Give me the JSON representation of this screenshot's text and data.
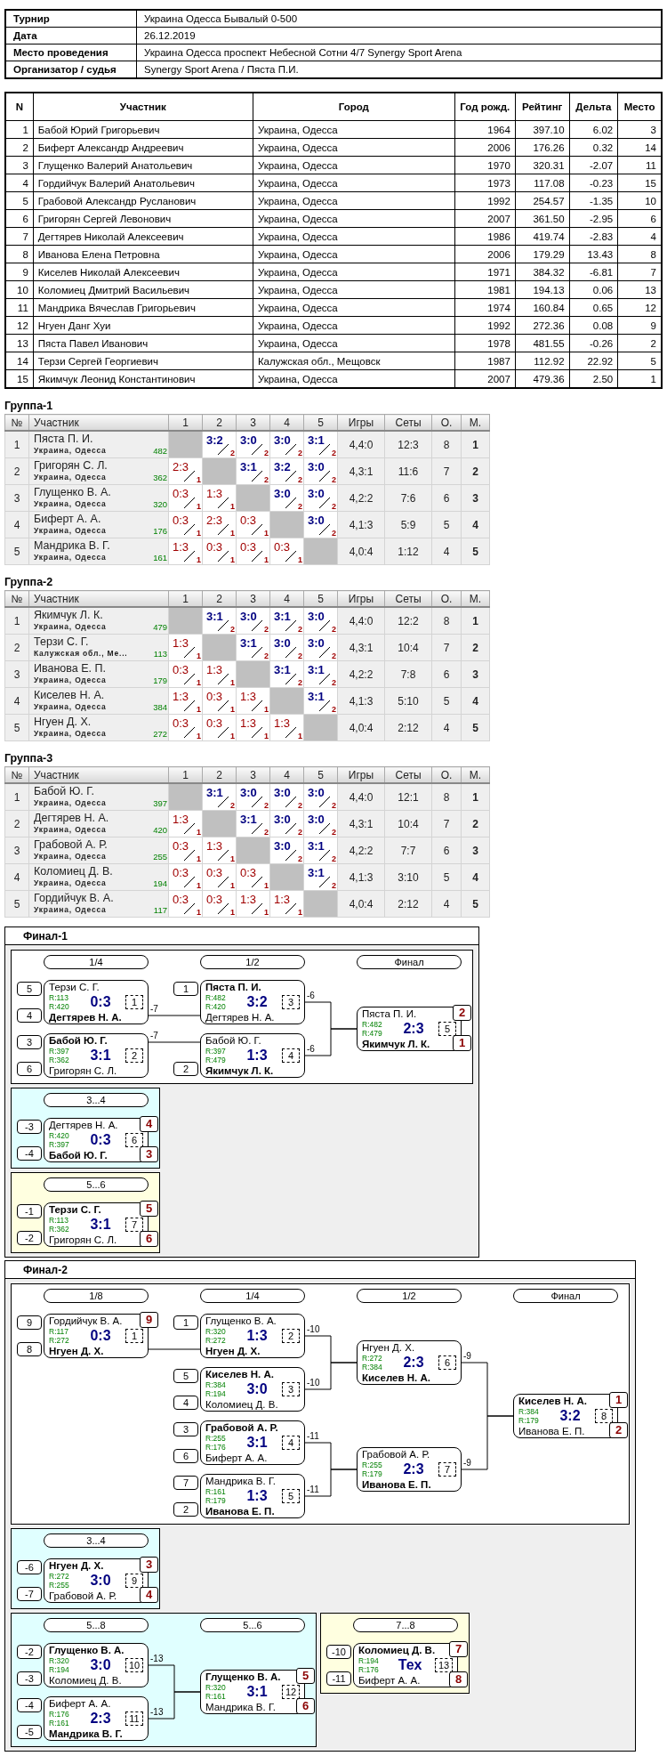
{
  "info": [
    {
      "label": "Турнир",
      "value": "Украина Одесса Бывалый 0-500"
    },
    {
      "label": "Дата",
      "value": "26.12.2019"
    },
    {
      "label": "Место проведения",
      "value": "Украина Одесса проспект Небесной Сотни 4/7 Synergy Sport Arena"
    },
    {
      "label": "Организатор / судья",
      "value": "Synergy Sport Arena / Пяста П.И."
    }
  ],
  "players": {
    "columns": [
      "N",
      "Участник",
      "Город",
      "Год рожд.",
      "Рейтинг",
      "Дельта",
      "Место"
    ],
    "rows": [
      [
        "1",
        "Бабой Юрий Григорьевич",
        "Украина, Одесса",
        "1964",
        "397.10",
        "6.02",
        "3"
      ],
      [
        "2",
        "Биферт Александр Андреевич",
        "Украина, Одесса",
        "2006",
        "176.26",
        "0.32",
        "14"
      ],
      [
        "3",
        "Глущенко Валерий Анатольевич",
        "Украина, Одесса",
        "1970",
        "320.31",
        "-2.07",
        "11"
      ],
      [
        "4",
        "Гордийчук Валерий Анатольевич",
        "Украина, Одесса",
        "1973",
        "117.08",
        "-0.23",
        "15"
      ],
      [
        "5",
        "Грабовой Александр Русланович",
        "Украина, Одесса",
        "1992",
        "254.57",
        "-1.35",
        "10"
      ],
      [
        "6",
        "Григорян Сергей Левонович",
        "Украина, Одесса",
        "2007",
        "361.50",
        "-2.95",
        "6"
      ],
      [
        "7",
        "Дегтярев Николай Алексеевич",
        "Украина, Одесса",
        "1986",
        "419.74",
        "-2.83",
        "4"
      ],
      [
        "8",
        "Иванова Елена Петровна",
        "Украина, Одесса",
        "2006",
        "179.29",
        "13.43",
        "8"
      ],
      [
        "9",
        "Киселев Николай Алексеевич",
        "Украина, Одесса",
        "1971",
        "384.32",
        "-6.81",
        "7"
      ],
      [
        "10",
        "Коломиец Дмитрий Васильевич",
        "Украина, Одесса",
        "1981",
        "194.13",
        "0.06",
        "13"
      ],
      [
        "11",
        "Мандрика Вячеслав Григорьевич",
        "Украина, Одесса",
        "1974",
        "160.84",
        "0.65",
        "12"
      ],
      [
        "12",
        "Нгуен Данг Хуи",
        "Украина, Одесса",
        "1992",
        "272.36",
        "0.08",
        "9"
      ],
      [
        "13",
        "Пяста Павел Иванович",
        "Украина, Одесса",
        "1978",
        "481.55",
        "-0.26",
        "2"
      ],
      [
        "14",
        "Терзи Сергей Георгиевич",
        "Калужская обл., Мещовск",
        "1987",
        "112.92",
        "22.92",
        "5"
      ],
      [
        "15",
        "Якимчук Леонид Константинович",
        "Украина, Одесса",
        "2007",
        "479.36",
        "2.50",
        "1"
      ]
    ]
  },
  "groups": [
    {
      "title": "Группа-1",
      "columns": [
        "№",
        "Участник"
      ],
      "opponents": [
        "1",
        "2",
        "3",
        "4",
        "5"
      ],
      "totals": [
        "Игры",
        "Сеты",
        "О.",
        "М."
      ],
      "rows": [
        {
          "no": "1",
          "player": {
            "name": "Пяста П. И.",
            "city": "Украина, Одесса",
            "rating": "482"
          },
          "cells": [
            {
              "kind": "self"
            },
            {
              "kind": "win",
              "score": "3:2",
              "points": "2"
            },
            {
              "kind": "win",
              "score": "3:0",
              "points": "2"
            },
            {
              "kind": "win",
              "score": "3:0",
              "points": "2"
            },
            {
              "kind": "win",
              "score": "3:1",
              "points": "2"
            }
          ],
          "games": "4,4:0",
          "sets": "12:3",
          "points": "8",
          "place": "1"
        },
        {
          "no": "2",
          "player": {
            "name": "Григорян С. Л.",
            "city": "Украина, Одесса",
            "rating": "362"
          },
          "cells": [
            {
              "kind": "loss",
              "score": "2:3",
              "points": "1"
            },
            {
              "kind": "self"
            },
            {
              "kind": "win",
              "score": "3:1",
              "points": "2"
            },
            {
              "kind": "win",
              "score": "3:2",
              "points": "2"
            },
            {
              "kind": "win",
              "score": "3:0",
              "points": "2"
            }
          ],
          "games": "4,3:1",
          "sets": "11:6",
          "points": "7",
          "place": "2"
        },
        {
          "no": "3",
          "player": {
            "name": "Глущенко В. А.",
            "city": "Украина, Одесса",
            "rating": "320"
          },
          "cells": [
            {
              "kind": "loss",
              "score": "0:3",
              "points": "1"
            },
            {
              "kind": "loss",
              "score": "1:3",
              "points": "1"
            },
            {
              "kind": "self"
            },
            {
              "kind": "win",
              "score": "3:0",
              "points": "2"
            },
            {
              "kind": "win",
              "score": "3:0",
              "points": "2"
            }
          ],
          "games": "4,2:2",
          "sets": "7:6",
          "points": "6",
          "place": "3"
        },
        {
          "no": "4",
          "player": {
            "name": "Биферт А. А.",
            "city": "Украина, Одесса",
            "rating": "176"
          },
          "cells": [
            {
              "kind": "loss",
              "score": "0:3",
              "points": "1"
            },
            {
              "kind": "loss",
              "score": "2:3",
              "points": "1"
            },
            {
              "kind": "loss",
              "score": "0:3",
              "points": "1"
            },
            {
              "kind": "self"
            },
            {
              "kind": "win",
              "score": "3:0",
              "points": "2"
            }
          ],
          "games": "4,1:3",
          "sets": "5:9",
          "points": "5",
          "place": "4"
        },
        {
          "no": "5",
          "player": {
            "name": "Мандрика В. Г.",
            "city": "Украина, Одесса",
            "rating": "161"
          },
          "cells": [
            {
              "kind": "loss",
              "score": "1:3",
              "points": "1"
            },
            {
              "kind": "loss",
              "score": "0:3",
              "points": "1"
            },
            {
              "kind": "loss",
              "score": "0:3",
              "points": "1"
            },
            {
              "kind": "loss",
              "score": "0:3",
              "points": "1"
            },
            {
              "kind": "self"
            }
          ],
          "games": "4,0:4",
          "sets": "1:12",
          "points": "4",
          "place": "5"
        }
      ]
    },
    {
      "title": "Группа-2",
      "columns": [
        "№",
        "Участник"
      ],
      "opponents": [
        "1",
        "2",
        "3",
        "4",
        "5"
      ],
      "totals": [
        "Игры",
        "Сеты",
        "О.",
        "М."
      ],
      "rows": [
        {
          "no": "1",
          "player": {
            "name": "Якимчук Л. К.",
            "city": "Украина, Одесса",
            "rating": "479"
          },
          "cells": [
            {
              "kind": "self"
            },
            {
              "kind": "win",
              "score": "3:1",
              "points": "2"
            },
            {
              "kind": "win",
              "score": "3:0",
              "points": "2"
            },
            {
              "kind": "win",
              "score": "3:1",
              "points": "2"
            },
            {
              "kind": "win",
              "score": "3:0",
              "points": "2"
            }
          ],
          "games": "4,4:0",
          "sets": "12:2",
          "points": "8",
          "place": "1"
        },
        {
          "no": "2",
          "player": {
            "name": "Терзи С. Г.",
            "city": "Калужская обл., Ме...",
            "rating": "113"
          },
          "cells": [
            {
              "kind": "loss",
              "score": "1:3",
              "points": "1"
            },
            {
              "kind": "self"
            },
            {
              "kind": "win",
              "score": "3:1",
              "points": "2"
            },
            {
              "kind": "win",
              "score": "3:0",
              "points": "2"
            },
            {
              "kind": "win",
              "score": "3:0",
              "points": "2"
            }
          ],
          "games": "4,3:1",
          "sets": "10:4",
          "points": "7",
          "place": "2"
        },
        {
          "no": "3",
          "player": {
            "name": "Иванова Е. П.",
            "city": "Украина, Одесса",
            "rating": "179"
          },
          "cells": [
            {
              "kind": "loss",
              "score": "0:3",
              "points": "1"
            },
            {
              "kind": "loss",
              "score": "1:3",
              "points": "1"
            },
            {
              "kind": "self"
            },
            {
              "kind": "win",
              "score": "3:1",
              "points": "2"
            },
            {
              "kind": "win",
              "score": "3:1",
              "points": "2"
            }
          ],
          "games": "4,2:2",
          "sets": "7:8",
          "points": "6",
          "place": "3"
        },
        {
          "no": "4",
          "player": {
            "name": "Киселев Н. А.",
            "city": "Украина, Одесса",
            "rating": "384"
          },
          "cells": [
            {
              "kind": "loss",
              "score": "1:3",
              "points": "1"
            },
            {
              "kind": "loss",
              "score": "0:3",
              "points": "1"
            },
            {
              "kind": "loss",
              "score": "1:3",
              "points": "1"
            },
            {
              "kind": "self"
            },
            {
              "kind": "win",
              "score": "3:1",
              "points": "2"
            }
          ],
          "games": "4,1:3",
          "sets": "5:10",
          "points": "5",
          "place": "4"
        },
        {
          "no": "5",
          "player": {
            "name": "Нгуен Д. Х.",
            "city": "Украина, Одесса",
            "rating": "272"
          },
          "cells": [
            {
              "kind": "loss",
              "score": "0:3",
              "points": "1"
            },
            {
              "kind": "loss",
              "score": "0:3",
              "points": "1"
            },
            {
              "kind": "loss",
              "score": "1:3",
              "points": "1"
            },
            {
              "kind": "loss",
              "score": "1:3",
              "points": "1"
            },
            {
              "kind": "self"
            }
          ],
          "games": "4,0:4",
          "sets": "2:12",
          "points": "4",
          "place": "5"
        }
      ]
    },
    {
      "title": "Группа-3",
      "columns": [
        "№",
        "Участник"
      ],
      "opponents": [
        "1",
        "2",
        "3",
        "4",
        "5"
      ],
      "totals": [
        "Игры",
        "Сеты",
        "О.",
        "М."
      ],
      "rows": [
        {
          "no": "1",
          "player": {
            "name": "Бабой Ю. Г.",
            "city": "Украина, Одесса",
            "rating": "397"
          },
          "cells": [
            {
              "kind": "self"
            },
            {
              "kind": "win",
              "score": "3:1",
              "points": "2"
            },
            {
              "kind": "win",
              "score": "3:0",
              "points": "2"
            },
            {
              "kind": "win",
              "score": "3:0",
              "points": "2"
            },
            {
              "kind": "win",
              "score": "3:0",
              "points": "2"
            }
          ],
          "games": "4,4:0",
          "sets": "12:1",
          "points": "8",
          "place": "1"
        },
        {
          "no": "2",
          "player": {
            "name": "Дегтярев Н. А.",
            "city": "Украина, Одесса",
            "rating": "420"
          },
          "cells": [
            {
              "kind": "loss",
              "score": "1:3",
              "points": "1"
            },
            {
              "kind": "self"
            },
            {
              "kind": "win",
              "score": "3:1",
              "points": "2"
            },
            {
              "kind": "win",
              "score": "3:0",
              "points": "2"
            },
            {
              "kind": "win",
              "score": "3:0",
              "points": "2"
            }
          ],
          "games": "4,3:1",
          "sets": "10:4",
          "points": "7",
          "place": "2"
        },
        {
          "no": "3",
          "player": {
            "name": "Грабовой А. Р.",
            "city": "Украина, Одесса",
            "rating": "255"
          },
          "cells": [
            {
              "kind": "loss",
              "score": "0:3",
              "points": "1"
            },
            {
              "kind": "loss",
              "score": "1:3",
              "points": "1"
            },
            {
              "kind": "self"
            },
            {
              "kind": "win",
              "score": "3:0",
              "points": "2"
            },
            {
              "kind": "win",
              "score": "3:1",
              "points": "2"
            }
          ],
          "games": "4,2:2",
          "sets": "7:7",
          "points": "6",
          "place": "3"
        },
        {
          "no": "4",
          "player": {
            "name": "Коломиец Д. В.",
            "city": "Украина, Одесса",
            "rating": "194"
          },
          "cells": [
            {
              "kind": "loss",
              "score": "0:3",
              "points": "1"
            },
            {
              "kind": "loss",
              "score": "0:3",
              "points": "1"
            },
            {
              "kind": "loss",
              "score": "0:3",
              "points": "1"
            },
            {
              "kind": "self"
            },
            {
              "kind": "win",
              "score": "3:1",
              "points": "2"
            }
          ],
          "games": "4,1:3",
          "sets": "3:10",
          "points": "5",
          "place": "4"
        },
        {
          "no": "5",
          "player": {
            "name": "Гордийчук В. А.",
            "city": "Украина, Одесса",
            "rating": "117"
          },
          "cells": [
            {
              "kind": "loss",
              "score": "0:3",
              "points": "1"
            },
            {
              "kind": "loss",
              "score": "0:3",
              "points": "1"
            },
            {
              "kind": "loss",
              "score": "1:3",
              "points": "1"
            },
            {
              "kind": "loss",
              "score": "1:3",
              "points": "1"
            },
            {
              "kind": "self"
            }
          ],
          "games": "4,0:4",
          "sets": "2:12",
          "points": "4",
          "place": "5"
        }
      ]
    }
  ],
  "finals": [
    {
      "title": "Финал-1",
      "panel_rows": [
        [
          {
            "color": "#ffffff",
            "rounds": [
              {
                "title": "1/4",
                "matches": [
                  {
                    "top": {
                      "seed": "5",
                      "name": "Терзи С. Г.",
                      "rating": "R:113",
                      "winner": false
                    },
                    "bottom": {
                      "seed": "4",
                      "name": "Дегтярев Н. А.",
                      "rating": "R:420",
                      "winner": true
                    },
                    "score": "0:3",
                    "number": "1",
                    "loser_to": "-7"
                  },
                  {
                    "top": {
                      "seed": "3",
                      "name": "Бабой Ю. Г.",
                      "rating": "R:397",
                      "winner": true
                    },
                    "bottom": {
                      "seed": "6",
                      "name": "Григорян С. Л.",
                      "rating": "R:362",
                      "winner": false
                    },
                    "score": "3:1",
                    "number": "2",
                    "loser_to": "-7"
                  }
                ]
              },
              {
                "title": "1/2",
                "matches": [
                  {
                    "top": {
                      "seed": "1",
                      "name": "Пяста П. И.",
                      "rating": "R:482",
                      "winner": true
                    },
                    "bottom": {
                      "name": "Дегтярев Н. А.",
                      "rating": "R:420",
                      "winner": false
                    },
                    "score": "3:2",
                    "number": "3",
                    "loser_to": "-6"
                  },
                  {
                    "top": {
                      "name": "Бабой Ю. Г.",
                      "rating": "R:397",
                      "winner": false
                    },
                    "bottom": {
                      "seed": "2",
                      "name": "Якимчук Л. К.",
                      "rating": "R:479",
                      "winner": true
                    },
                    "score": "1:3",
                    "number": "4",
                    "loser_to": "-6"
                  }
                ]
              },
              {
                "title": "Финал",
                "matches": [
                  {
                    "top": {
                      "name": "Пяста П. И.",
                      "rating": "R:482",
                      "winner": false,
                      "place": "2"
                    },
                    "bottom": {
                      "name": "Якимчук Л. К.",
                      "rating": "R:479",
                      "winner": true,
                      "place": "1"
                    },
                    "score": "2:3",
                    "number": "5"
                  }
                ]
              }
            ]
          }
        ],
        [
          {
            "color": "#e0ffff",
            "rounds": [
              {
                "title": "3...4",
                "matches": [
                  {
                    "top": {
                      "seed": "-3",
                      "name": "Дегтярев Н. А.",
                      "rating": "R:420",
                      "winner": false,
                      "place": "4"
                    },
                    "bottom": {
                      "seed": "-4",
                      "name": "Бабой Ю. Г.",
                      "rating": "R:397",
                      "winner": true,
                      "place": "3"
                    },
                    "score": "0:3",
                    "number": "6"
                  }
                ]
              }
            ]
          }
        ],
        [
          {
            "color": "#ffffe0",
            "rounds": [
              {
                "title": "5...6",
                "matches": [
                  {
                    "top": {
                      "seed": "-1",
                      "name": "Терзи С. Г.",
                      "rating": "R:113",
                      "winner": true,
                      "place": "5"
                    },
                    "bottom": {
                      "seed": "-2",
                      "name": "Григорян С. Л.",
                      "rating": "R:362",
                      "winner": false,
                      "place": "6"
                    },
                    "score": "3:1",
                    "number": "7"
                  }
                ]
              }
            ]
          }
        ]
      ]
    },
    {
      "title": "Финал-2",
      "panel_rows": [
        [
          {
            "color": "#ffffff",
            "rounds": [
              {
                "title": "1/8",
                "matches": [
                  {
                    "top": {
                      "seed": "9",
                      "name": "Гордийчук В. А.",
                      "rating": "R:117",
                      "winner": false,
                      "place": "9"
                    },
                    "bottom": {
                      "seed": "8",
                      "name": "Нгуен Д. Х.",
                      "rating": "R:272",
                      "winner": true
                    },
                    "score": "0:3",
                    "number": "1"
                  }
                ]
              },
              {
                "title": "1/4",
                "matches": [
                  {
                    "top": {
                      "seed": "1",
                      "name": "Глущенко В. А.",
                      "rating": "R:320",
                      "winner": false
                    },
                    "bottom": {
                      "name": "Нгуен Д. Х.",
                      "rating": "R:272",
                      "winner": true
                    },
                    "score": "1:3",
                    "number": "2",
                    "loser_to": "-10"
                  },
                  {
                    "top": {
                      "seed": "5",
                      "name": "Киселев Н. А.",
                      "rating": "R:384",
                      "winner": true
                    },
                    "bottom": {
                      "seed": "4",
                      "name": "Коломиец Д. В.",
                      "rating": "R:194",
                      "winner": false
                    },
                    "score": "3:0",
                    "number": "3",
                    "loser_to": "-10"
                  },
                  {
                    "top": {
                      "seed": "3",
                      "name": "Грабовой А. Р.",
                      "rating": "R:255",
                      "winner": true
                    },
                    "bottom": {
                      "seed": "6",
                      "name": "Биферт А. А.",
                      "rating": "R:176",
                      "winner": false
                    },
                    "score": "3:1",
                    "number": "4",
                    "loser_to": "-11"
                  },
                  {
                    "top": {
                      "seed": "7",
                      "name": "Мандрика В. Г.",
                      "rating": "R:161",
                      "winner": false
                    },
                    "bottom": {
                      "seed": "2",
                      "name": "Иванова Е. П.",
                      "rating": "R:179",
                      "winner": true
                    },
                    "score": "1:3",
                    "number": "5",
                    "loser_to": "-11"
                  }
                ]
              },
              {
                "title": "1/2",
                "matches": [
                  {
                    "top": {
                      "name": "Нгуен Д. Х.",
                      "rating": "R:272",
                      "winner": false
                    },
                    "bottom": {
                      "name": "Киселев Н. А.",
                      "rating": "R:384",
                      "winner": true
                    },
                    "score": "2:3",
                    "number": "6",
                    "loser_to": "-9"
                  },
                  {
                    "top": {
                      "name": "Грабовой А. Р.",
                      "rating": "R:255",
                      "winner": false
                    },
                    "bottom": {
                      "name": "Иванова Е. П.",
                      "rating": "R:179",
                      "winner": true
                    },
                    "score": "2:3",
                    "number": "7",
                    "loser_to": "-9"
                  }
                ]
              },
              {
                "title": "Финал",
                "matches": [
                  {
                    "top": {
                      "name": "Киселев Н. А.",
                      "rating": "R:384",
                      "winner": true,
                      "place": "1"
                    },
                    "bottom": {
                      "name": "Иванова Е. П.",
                      "rating": "R:179",
                      "winner": false,
                      "place": "2"
                    },
                    "score": "3:2",
                    "number": "8"
                  }
                ]
              }
            ]
          }
        ],
        [
          {
            "color": "#e0ffff",
            "rounds": [
              {
                "title": "3...4",
                "matches": [
                  {
                    "top": {
                      "seed": "-6",
                      "name": "Нгуен Д. Х.",
                      "rating": "R:272",
                      "winner": true,
                      "place": "3"
                    },
                    "bottom": {
                      "seed": "-7",
                      "name": "Грабовой А. Р.",
                      "rating": "R:255",
                      "winner": false,
                      "place": "4"
                    },
                    "score": "3:0",
                    "number": "9"
                  }
                ]
              }
            ]
          }
        ],
        [
          {
            "color": "#e0ffff",
            "rounds": [
              {
                "title": "5...8",
                "matches": [
                  {
                    "top": {
                      "seed": "-2",
                      "name": "Глущенко В. А.",
                      "rating": "R:320",
                      "winner": true
                    },
                    "bottom": {
                      "seed": "-3",
                      "name": "Коломиец Д. В.",
                      "rating": "R:194",
                      "winner": false
                    },
                    "score": "3:0",
                    "number": "10",
                    "loser_to": "-13"
                  },
                  {
                    "top": {
                      "seed": "-4",
                      "name": "Биферт А. А.",
                      "rating": "R:176",
                      "winner": false
                    },
                    "bottom": {
                      "seed": "-5",
                      "name": "Мандрика В. Г.",
                      "rating": "R:161",
                      "winner": true
                    },
                    "score": "2:3",
                    "number": "11",
                    "loser_to": "-13"
                  }
                ]
              },
              {
                "title": "5...6",
                "matches": [
                  {
                    "top": {
                      "name": "Глущенко В. А.",
                      "rating": "R:320",
                      "winner": true,
                      "place": "5"
                    },
                    "bottom": {
                      "name": "Мандрика В. Г.",
                      "rating": "R:161",
                      "winner": false,
                      "place": "6"
                    },
                    "score": "3:1",
                    "number": "12"
                  }
                ]
              }
            ]
          },
          {
            "color": "#ffffe0",
            "rounds": [
              {
                "title": "7...8",
                "matches": [
                  {
                    "top": {
                      "seed": "-10",
                      "name": "Коломиец Д. В.",
                      "rating": "R:194",
                      "winner": true,
                      "place": "7"
                    },
                    "bottom": {
                      "seed": "-11",
                      "name": "Биферт А. А.",
                      "rating": "R:176",
                      "winner": false,
                      "place": "8"
                    },
                    "score": "Тех",
                    "number": "13"
                  }
                ]
              }
            ]
          }
        ]
      ]
    }
  ]
}
